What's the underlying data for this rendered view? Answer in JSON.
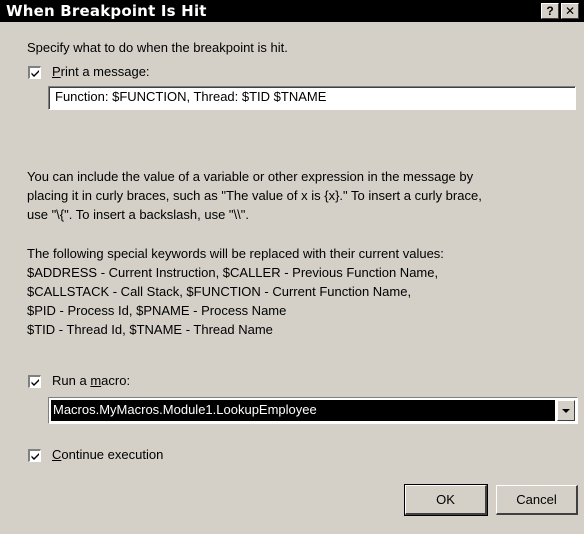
{
  "window": {
    "title": "When Breakpoint Is Hit",
    "help_glyph": "?",
    "close_glyph": "✕"
  },
  "intro": "Specify what to do when the breakpoint is hit.",
  "print_message": {
    "checked": true,
    "label_pre": "",
    "label_accel": "P",
    "label_post": "rint a message:",
    "value": "Function: $FUNCTION, Thread: $TID $TNAME"
  },
  "help": {
    "para1": [
      "You can include the value of a variable or other expression in the message by",
      "placing it in curly braces, such as \"The value of x is {x}.\" To insert a curly brace,",
      "use \"\\{\". To insert a backslash, use \"\\\\\"."
    ],
    "para2": [
      "The following special keywords will be replaced with their current values:",
      "$ADDRESS - Current Instruction, $CALLER - Previous Function Name,",
      "$CALLSTACK - Call Stack, $FUNCTION - Current Function Name,",
      "$PID - Process Id, $PNAME - Process Name",
      "$TID - Thread Id, $TNAME - Thread Name"
    ]
  },
  "run_macro": {
    "checked": true,
    "label_pre": "Run a ",
    "label_accel": "m",
    "label_post": "acro:",
    "selected": "Macros.MyMacros.Module1.LookupEmployee"
  },
  "continue_execution": {
    "checked": true,
    "label_pre": "",
    "label_accel": "C",
    "label_post": "ontinue execution"
  },
  "buttons": {
    "ok": "OK",
    "cancel": "Cancel"
  }
}
